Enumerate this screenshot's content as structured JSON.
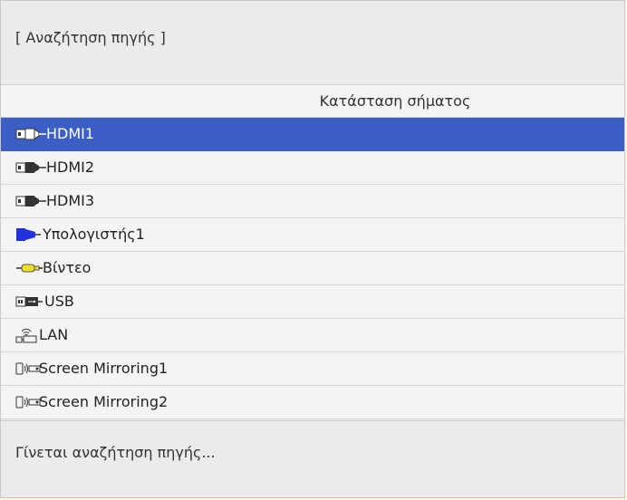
{
  "dialog": {
    "title": "[ Αναζήτηση πηγής ]",
    "column_header": "Κατάσταση σήματος",
    "status": "Γίνεται αναζήτηση πηγής..."
  },
  "sources": [
    {
      "label": "HDMI1",
      "icon": "hdmi-icon",
      "selected": true
    },
    {
      "label": "HDMI2",
      "icon": "hdmi-icon",
      "selected": false
    },
    {
      "label": "HDMI3",
      "icon": "hdmi-icon",
      "selected": false
    },
    {
      "label": "Υπολογιστής1",
      "icon": "computer-vga-icon",
      "selected": false
    },
    {
      "label": "Βίντεο",
      "icon": "video-rca-icon",
      "selected": false
    },
    {
      "label": "USB",
      "icon": "usb-icon",
      "selected": false
    },
    {
      "label": "LAN",
      "icon": "lan-icon",
      "selected": false
    },
    {
      "label": "Screen Mirroring1",
      "icon": "screen-mirroring-icon",
      "selected": false
    },
    {
      "label": "Screen Mirroring2",
      "icon": "screen-mirroring-icon",
      "selected": false
    }
  ],
  "colors": {
    "selection": "#3b5fc4",
    "vga_blue": "#2233dd",
    "video_yellow": "#f2e12a"
  }
}
